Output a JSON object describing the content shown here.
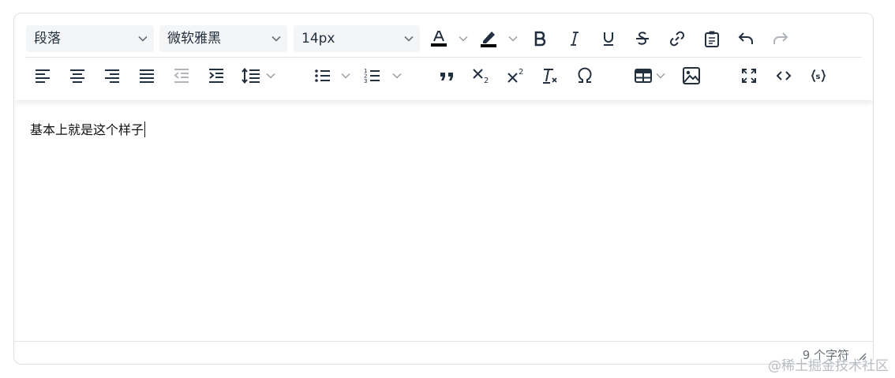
{
  "toolbar": {
    "block_format": "段落",
    "font_family": "微软雅黑",
    "font_size": "14px"
  },
  "icons": {
    "row1": [
      "forecolor-icon",
      "backcolor-icon",
      "bold-icon",
      "italic-icon",
      "underline-icon",
      "strikethrough-icon",
      "link-icon",
      "paste-icon",
      "undo-icon",
      "redo-icon"
    ],
    "row2": [
      "align-left-icon",
      "align-center-icon",
      "align-right-icon",
      "align-justify-icon",
      "outdent-icon",
      "indent-icon",
      "line-height-icon",
      "bullet-list-icon",
      "numbered-list-icon",
      "blockquote-icon",
      "subscript-icon",
      "superscript-icon",
      "remove-format-icon",
      "special-char-icon",
      "table-icon",
      "image-icon",
      "fullscreen-icon",
      "code-view-icon",
      "code-sample-icon"
    ]
  },
  "colors": {
    "text_color": "#000000",
    "highlight_color": "#000000",
    "icon_color": "#222f3e"
  },
  "content": {
    "text": "基本上就是这个样子"
  },
  "status": {
    "char_count": "9 个字符"
  },
  "watermark": "@稀土掘金技术社区"
}
